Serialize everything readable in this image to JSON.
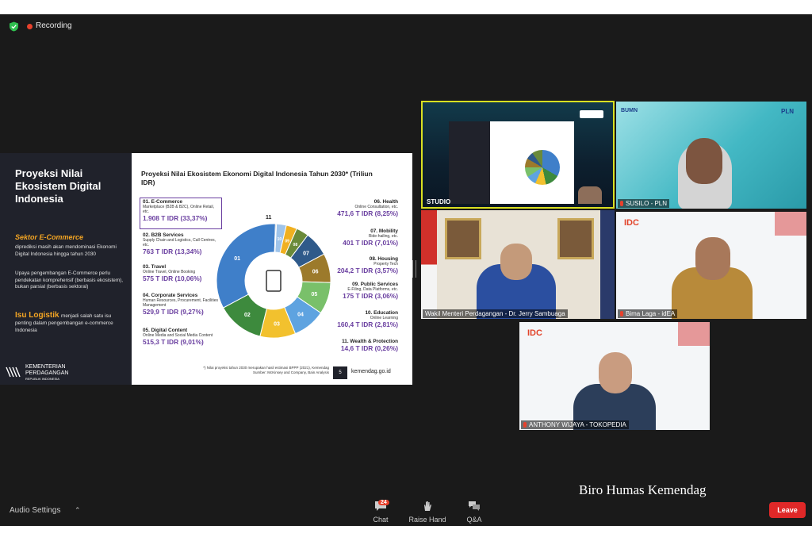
{
  "topbar": {
    "recording_label": "Recording"
  },
  "slide": {
    "left_title": "Proyeksi Nilai Ekosistem Digital Indonesia",
    "p1_heading": "Sektor E-Commerce",
    "p1_text": "diprediksi masih akan mendominasi Ekonomi Digital Indonesia hingga tahun 2030",
    "p2_text": "Upaya pengembangan E-Commerce perlu pendekatan komprehensif (berbasis ekosistem), bukan parsial (berbasis sektoral)",
    "p3_heading": "Isu Logistik",
    "p3_text": "menjadi salah satu isu penting dalam pengembangan e-commerce Indonesia",
    "ministry_name": "KEMENTERIAN PERDAGANGAN",
    "ministry_sub": "REPUBLIK INDONESIA",
    "chart_title": "Proyeksi Nilai Ekosistem Ekonomi Digital Indonesia Tahun 2030* (Triliun IDR)",
    "footnote": "*) Nilai proyeksi tahun 2030 merupakan hasil estimasi BPPP (2021), Kemendag Sumber: McKinsey and Company, Bain Analysis",
    "page_number": "5",
    "url": "kemendag.go.id",
    "left_sectors": [
      {
        "name": "01. E-Commerce",
        "desc": "Marketplace (B2B & B2C), Online Retail, etc.",
        "value": "1.908 T IDR (33,37%)"
      },
      {
        "name": "02. B2B Services",
        "desc": "Supply Chain and Logistics, Call Centres, etc.",
        "value": "763 T IDR (13,34%)"
      },
      {
        "name": "03. Travel",
        "desc": "Online Travel, Online Booking",
        "value": "575 T IDR (10,06%)"
      },
      {
        "name": "04. Corporate Services",
        "desc": "Human Resources, Procurement, Facilities Management",
        "value": "529,9 T IDR (9,27%)"
      },
      {
        "name": "05. Digital Content",
        "desc": "Online Media and Social Media Content",
        "value": "515,3 T IDR (9,01%)"
      }
    ],
    "right_sectors": [
      {
        "name": "06. Health",
        "desc": "Online Consultation, etc.",
        "value": "471,6 T IDR (8,25%)"
      },
      {
        "name": "07. Mobility",
        "desc": "Ride-hailing, etc.",
        "value": "401 T IDR (7,01%)"
      },
      {
        "name": "08. Housing",
        "desc": "Property Tech",
        "value": "204,2 T IDR (3,57%)"
      },
      {
        "name": "09. Public Services",
        "desc": "E-Filing, Data Platforms, etc.",
        "value": "175 T IDR (3,06%)"
      },
      {
        "name": "10. Education",
        "desc": "Online Learning",
        "value": "160,4 T IDR (2,81%)"
      },
      {
        "name": "11. Wealth & Protection",
        "desc": "",
        "value": "14,6 T IDR (0,26%)"
      }
    ],
    "donut": {
      "labels": [
        "01",
        "02",
        "03",
        "04",
        "05",
        "06",
        "07",
        "08",
        "09",
        "10",
        "11"
      ],
      "shares": [
        33.37,
        13.34,
        10.06,
        9.27,
        9.01,
        8.25,
        7.01,
        3.57,
        3.06,
        2.81,
        0.26
      ],
      "colors": [
        "#3f7fc9",
        "#3d8a3d",
        "#f2c12e",
        "#5ea3e0",
        "#79c06a",
        "#9c7a2b",
        "#2f5a8a",
        "#6a8a3a",
        "#f0b020",
        "#9fc4ea",
        "#444444"
      ]
    }
  },
  "tiles": {
    "studio": "STUDIO",
    "pln": "SUSILO - PLN",
    "minister": "Wakil Menteri Perdagangan - Dr. Jerry Sambuaga",
    "idea": "Bima Laga - idEA",
    "tokopedia": "ANTHONY WIJAYA - TOKOPEDIA",
    "pln_logo": "PLN",
    "idc_logo": "IDC"
  },
  "controls": {
    "audio_settings": "Audio Settings",
    "chat": "Chat",
    "chat_badge": "24",
    "raise_hand": "Raise Hand",
    "qa": "Q&A",
    "leave": "Leave"
  },
  "watermark": "Biro Humas Kemendag"
}
